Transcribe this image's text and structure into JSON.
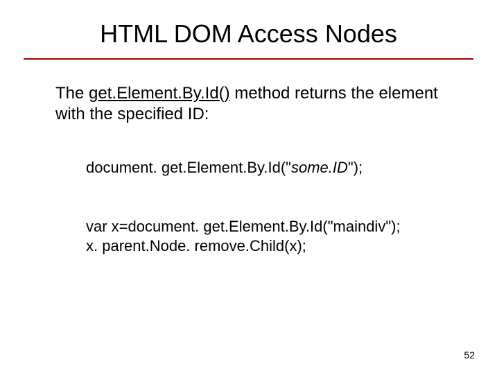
{
  "slide": {
    "title": "HTML DOM Access Nodes",
    "paragraph": {
      "prefix": "The ",
      "method": "get.Element.By.Id()",
      "suffix": " method returns the element with the specified ID:"
    },
    "code1": {
      "prefix": "document. get.Element.By.Id(\"",
      "param": "some.ID",
      "suffix": "\");"
    },
    "code2": {
      "line1": "var x=document. get.Element.By.Id(\"maindiv\");",
      "line2": "x. parent.Node. remove.Child(x);"
    },
    "pageNumber": "52"
  }
}
